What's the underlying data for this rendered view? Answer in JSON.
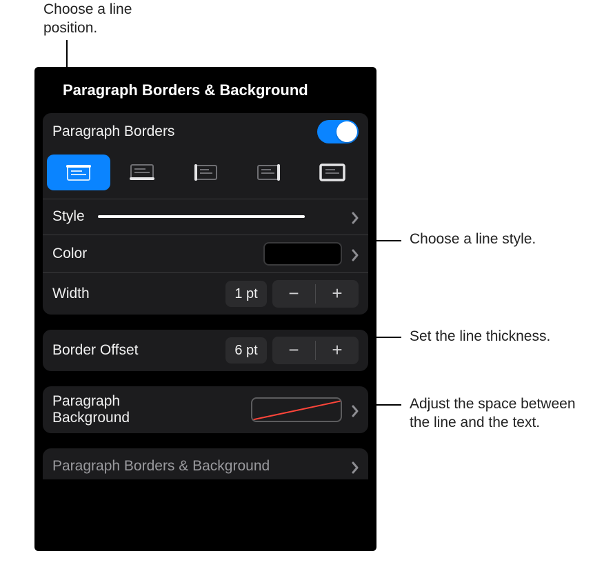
{
  "callouts": {
    "linePosition": "Choose a line position.",
    "lineStyle": "Choose a line style.",
    "lineThickness": "Set the line thickness.",
    "borderOffset": "Adjust the space between the line and the text."
  },
  "panel": {
    "title": "Paragraph Borders & Background",
    "borders": {
      "toggleLabel": "Paragraph Borders",
      "toggleOn": true,
      "selectedPosition": "top",
      "styleLabel": "Style",
      "colorLabel": "Color",
      "colorHex": "#000000",
      "widthLabel": "Width",
      "widthValue": "1 pt"
    },
    "offset": {
      "label": "Border Offset",
      "value": "6 pt"
    },
    "background": {
      "label": "Paragraph Background"
    },
    "navBack": "Paragraph Borders & Background"
  },
  "stepper": {
    "minusGlyph": "−",
    "plusGlyph": "+"
  }
}
